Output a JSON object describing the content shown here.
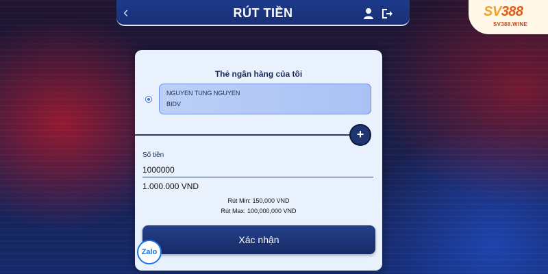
{
  "header": {
    "back_icon": "chevron-left-icon",
    "title": "RÚT TIỀN",
    "user_icon": "user-icon",
    "logout_icon": "logout-icon"
  },
  "logo": {
    "brand_prefix": "SV",
    "brand_number": "388",
    "site": "SV388.WINE"
  },
  "card": {
    "title": "Thẻ ngân hàng của tôi",
    "bank_card": {
      "holder": "NGUYEN TUNG NGUYEN",
      "bank": "BIDV",
      "selected": true
    },
    "add_button": "+",
    "amount": {
      "label": "Số tiền",
      "value": "1000000",
      "formatted": "1.000.000 VND"
    },
    "limits": {
      "min": "Rút Min: 150,000 VND",
      "max": "Rút Max: 100,000,000 VND"
    },
    "confirm_label": "Xác nhận"
  },
  "chat_widget": {
    "label": "Zalo"
  },
  "colors": {
    "primary": "#1e3570",
    "card_bg": "#e9f1fc",
    "bank_card_bg": "#bcd0f6",
    "logo_orange": "#e35a12"
  }
}
